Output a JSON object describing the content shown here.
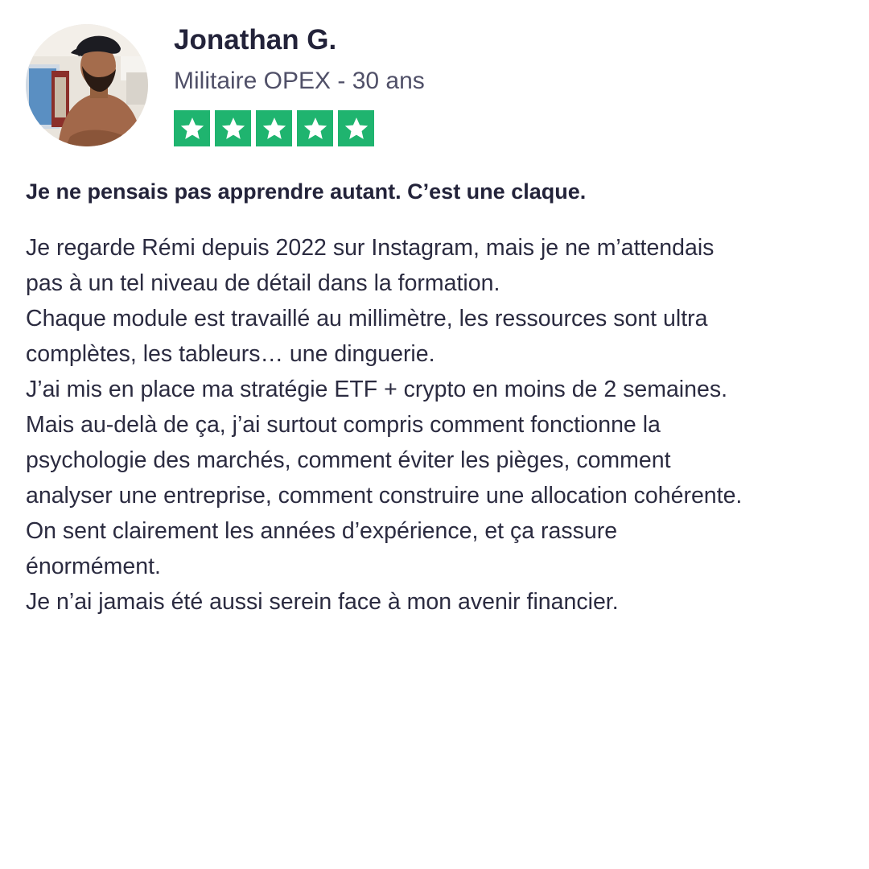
{
  "reviewer": {
    "name": "Jonathan G.",
    "subtitle": "Militaire OPEX - 30 ans",
    "avatar_icon": "profile-photo"
  },
  "rating": {
    "value": 5,
    "max": 5,
    "star_color": "#1fb46f",
    "star_icon": "star-icon"
  },
  "review": {
    "title": "Je ne pensais pas apprendre autant. C’est une claque.",
    "lines": [
      "Je regarde Rémi depuis 2022 sur Instagram, mais je ne m’attendais",
      "pas à un tel niveau de détail dans la formation.",
      "Chaque module est travaillé au millimètre, les ressources sont ultra",
      "complètes, les tableurs… une dinguerie.",
      "J’ai mis en place ma stratégie ETF + crypto en moins de 2 semaines.",
      "Mais au-delà de ça, j’ai surtout compris comment fonctionne la",
      "psychologie des marchés, comment éviter les pièges, comment",
      "analyser une entreprise, comment construire une allocation cohérente.",
      "On sent clairement les années d’expérience, et ça rassure",
      "énormément.",
      "Je n’ai jamais été aussi serein face à mon avenir financier."
    ]
  }
}
